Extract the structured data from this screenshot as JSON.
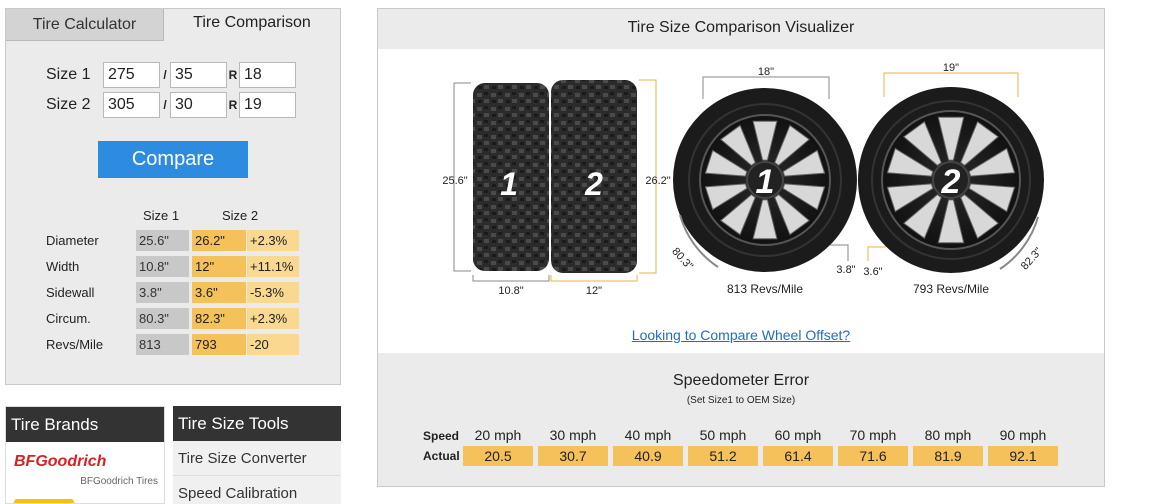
{
  "tabs": {
    "calculator": "Tire Calculator",
    "comparison": "Tire Comparison"
  },
  "inputs": {
    "size1_label": "Size 1",
    "size2_label": "Size 2",
    "slash": "/",
    "r": "R",
    "size1": {
      "width": "275",
      "aspect": "35",
      "rim": "18"
    },
    "size2": {
      "width": "305",
      "aspect": "30",
      "rim": "19"
    }
  },
  "compare_label": "Compare",
  "comparison": {
    "col1": "Size 1",
    "col2": "Size 2",
    "rows": [
      {
        "label": "Diameter",
        "v1": "25.6\"",
        "v2": "26.2\"",
        "diff": "+2.3%"
      },
      {
        "label": "Width",
        "v1": "10.8\"",
        "v2": "12\"",
        "diff": "+11.1%"
      },
      {
        "label": "Sidewall",
        "v1": "3.8\"",
        "v2": "3.6\"",
        "diff": "-5.3%"
      },
      {
        "label": "Circum.",
        "v1": "80.3\"",
        "v2": "82.3\"",
        "diff": "+2.3%"
      },
      {
        "label": "Revs/Mile",
        "v1": "813",
        "v2": "793",
        "diff": "-20"
      }
    ]
  },
  "brands": {
    "title": "Tire Brands",
    "logo1_a": "BF",
    "logo1_b": "Goodrich",
    "logo1_sub": "BFGoodrich Tires"
  },
  "tools": {
    "title": "Tire Size Tools",
    "items": [
      "Tire Size Converter",
      "Speed Calibration"
    ]
  },
  "visualizer": {
    "title": "Tire Size Comparison Visualizer",
    "tire1_num": "1",
    "tire2_num": "2",
    "dia1": "25.6\"",
    "dia2": "26.2\"",
    "width1": "10.8\"",
    "width2": "12\"",
    "rim1": "18\"",
    "rim2": "19\"",
    "side1": "3.8\"",
    "side2": "3.6\"",
    "circ1": "80.3\"",
    "circ2": "82.3\"",
    "revs1": "813 Revs/Mile",
    "revs2": "793 Revs/Mile",
    "offset_link": "Looking to Compare Wheel Offset?"
  },
  "speedometer": {
    "title": "Speedometer Error",
    "subtitle": "(Set Size1 to OEM Size)",
    "speed_label": "Speed",
    "actual_label": "Actual",
    "speeds": [
      "20 mph",
      "30 mph",
      "40 mph",
      "50 mph",
      "60 mph",
      "70 mph",
      "80 mph",
      "90 mph"
    ],
    "actual": [
      "20.5",
      "30.7",
      "40.9",
      "51.2",
      "61.4",
      "71.6",
      "81.9",
      "92.1"
    ]
  },
  "colors": {
    "accent": "#2e8ce0",
    "highlight": "#f5c15a",
    "highlight_light": "#f9d890",
    "gray_cell": "#c8c8c8",
    "dim_line": "#f0b040"
  }
}
